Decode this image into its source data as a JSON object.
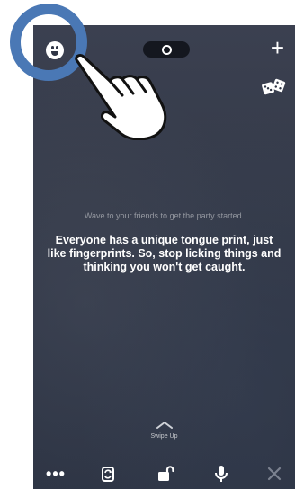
{
  "hint_text": "Wave to your friends to get the party started.",
  "fact_text": "Everyone has a unique tongue print, just like fingerprints. So, stop licking things and thinking you won't get caught.",
  "swipe_label": "Swipe Up",
  "icons": {
    "top_left": "emoji-face-icon",
    "top_center": "camera-mode-pill",
    "top_right": "plus-icon",
    "dice": "dice-icon",
    "bottom": [
      "more-dots-icon",
      "flip-camera-icon",
      "unlock-icon",
      "microphone-icon",
      "close-icon"
    ]
  },
  "colors": {
    "tutorial_ring": "#4a78b5",
    "screen_bg": "#353b4a",
    "pill_bg": "#14171f"
  }
}
